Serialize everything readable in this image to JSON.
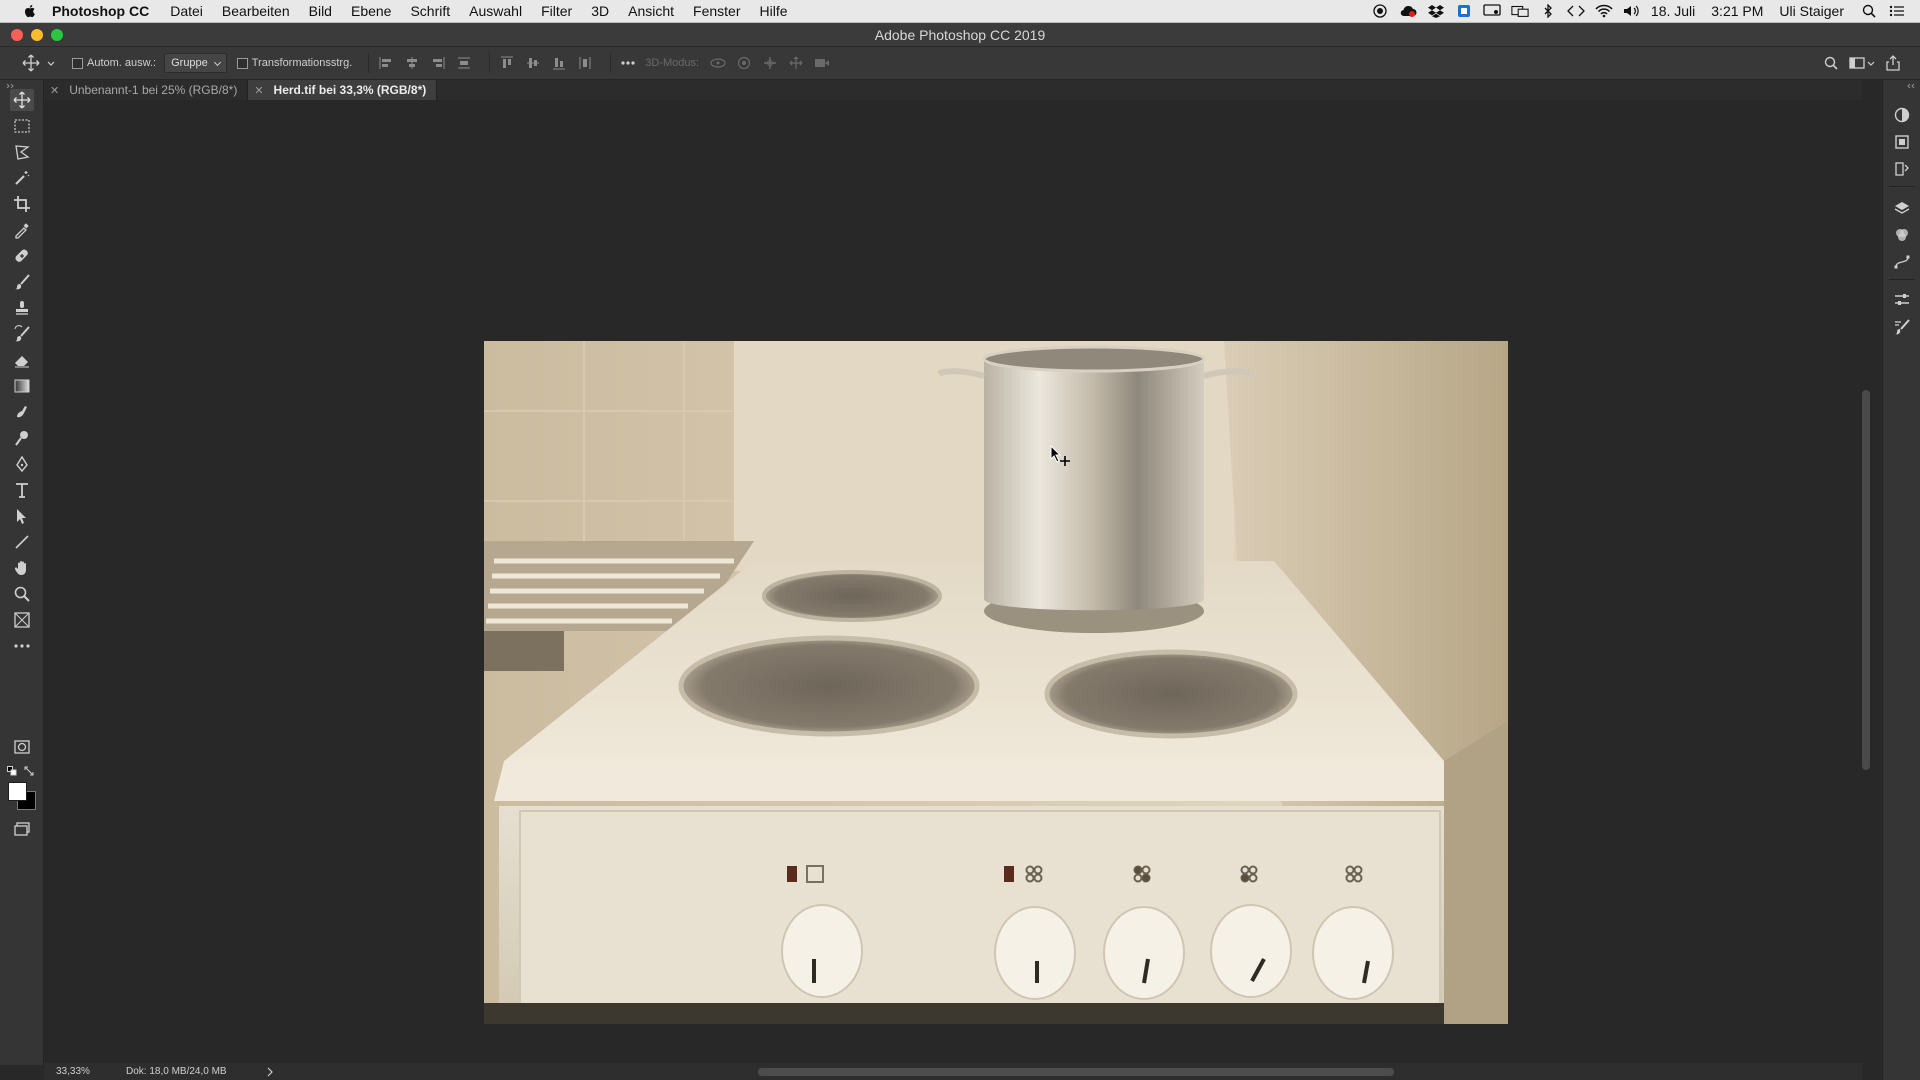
{
  "menubar": {
    "app_name": "Photoshop CC",
    "items": [
      "Datei",
      "Bearbeiten",
      "Bild",
      "Ebene",
      "Schrift",
      "Auswahl",
      "Filter",
      "3D",
      "Ansicht",
      "Fenster",
      "Hilfe"
    ],
    "date": "18. Juli",
    "time": "3:21 PM",
    "user": "Uli Staiger"
  },
  "window": {
    "title": "Adobe Photoshop CC 2019"
  },
  "options": {
    "auto_select_label": "Autom. ausw.:",
    "auto_select_checked": false,
    "group_value": "Gruppe",
    "transform_label": "Transformationsstrg.",
    "transform_checked": false,
    "mode_3d_label": "3D-Modus:"
  },
  "tabs": [
    {
      "label": "Unbenannt-1 bei 25% (RGB/8*)",
      "active": false
    },
    {
      "label": "Herd.tif bei 33,3% (RGB/8*)",
      "active": true
    }
  ],
  "tools": [
    "move-tool",
    "marquee-tool",
    "lasso-tool",
    "magic-wand-tool",
    "crop-tool",
    "eyedropper-tool",
    "healing-brush-tool",
    "brush-tool",
    "clone-stamp-tool",
    "history-brush-tool",
    "eraser-tool",
    "gradient-tool",
    "smudge-tool",
    "dodge-tool",
    "pen-tool",
    "type-tool",
    "path-selection-tool",
    "line-tool",
    "hand-tool",
    "zoom-tool",
    "frame-tool",
    "more-tools"
  ],
  "colors": {
    "foreground": "#ffffff",
    "background": "#000000",
    "ui_dark": "#282828",
    "panel": "#353535"
  },
  "status": {
    "zoom": "33,33%",
    "doc_info": "Dok: 18,0 MB/24,0 MB"
  }
}
